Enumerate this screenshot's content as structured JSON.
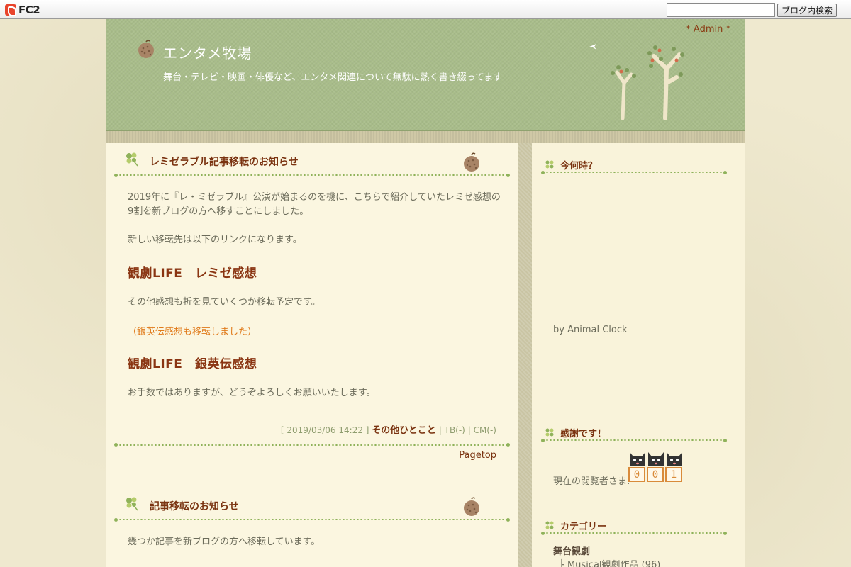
{
  "fc2bar": {
    "logo_text": "FC2",
    "search_placeholder": "",
    "search_button": "ブログ内検索"
  },
  "header": {
    "admin_link": "* Admin *",
    "title": "エンタメ牧場",
    "description": "舞台・テレビ・映画・俳優など、エンタメ関連について無駄に熱く書き綴ってます"
  },
  "entries": [
    {
      "title": "レミゼラブル記事移転のお知らせ",
      "para1": "2019年に『レ・ミゼラブル』公演が始まるのを機に、こちらで紹介していたレミゼ感想の9割を新ブログの方へ移すことにしました。",
      "para2": "新しい移転先は以下のリンクになります。",
      "link1": "観劇LIFE　レミゼ感想",
      "para3": "その他感想も折を見ていくつか移転予定です。",
      "note": "（銀英伝感想も移転しました）",
      "link2": "観劇LIFE　銀英伝感想",
      "para4": "お手数ではありますが、どうぞよろしくお願いいたします。",
      "meta_date": "[ 2019/03/06 14:22 ]",
      "meta_category": "その他ひとこと",
      "meta_tb": "TB(-)",
      "meta_cm": "CM(-)",
      "pagetop": "Pagetop"
    },
    {
      "title": "記事移転のお知らせ",
      "para1": "幾つか記事を新ブログの方へ移転しています。"
    }
  ],
  "sidebar": {
    "clock_title": "今何時？",
    "clock_credit": "by Animal Clock",
    "counter_title": "感謝です！",
    "counter_label": "現在の閲覧者さま:",
    "counter_digits": [
      "0",
      "0",
      "1"
    ],
    "category_title": "カテゴリー",
    "category_group": "舞台観劇",
    "category_item": "├ Musical観劇作品 (96)"
  },
  "colors": {
    "header_bg": "#a9bd8a",
    "title_accent": "#7a3310",
    "link_orange": "#e07a1a",
    "dot_green": "#8fb25a"
  }
}
